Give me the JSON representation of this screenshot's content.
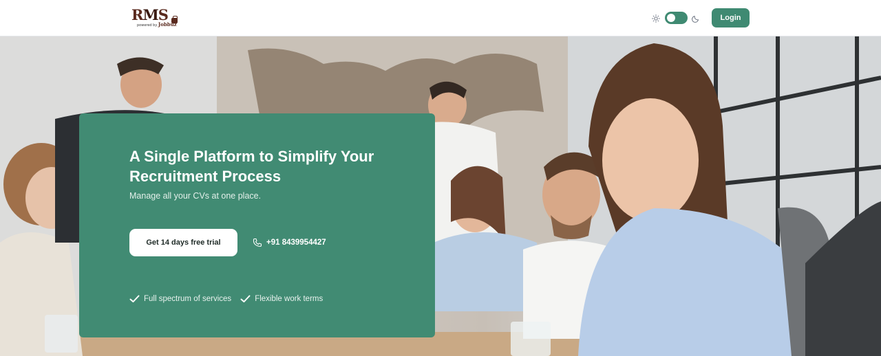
{
  "header": {
    "logo": {
      "brand_r": "R",
      "brand_m": "M",
      "brand_s": "S",
      "powered_by": "powered by",
      "powered_by_brand": "Jobbuz"
    },
    "theme_toggle": {
      "state": "light",
      "sun_icon": "sun-icon",
      "moon_icon": "moon-icon"
    },
    "login_label": "Login"
  },
  "hero": {
    "title": "A Single Platform to Simplify Your Recruitment Process",
    "subtitle": "Manage all your CVs at one place.",
    "cta_label": "Get 14 days free trial",
    "phone": {
      "icon": "phone-icon",
      "label": "+91 8439954427"
    },
    "features": [
      {
        "icon": "check-icon",
        "label": "Full spectrum of services"
      },
      {
        "icon": "check-icon",
        "label": "Flexible work terms"
      }
    ]
  },
  "colors": {
    "accent": "#418b73",
    "toggle": "#3f8a72",
    "brand_text": "#5a2a1e",
    "header_bg": "#ffffff"
  }
}
